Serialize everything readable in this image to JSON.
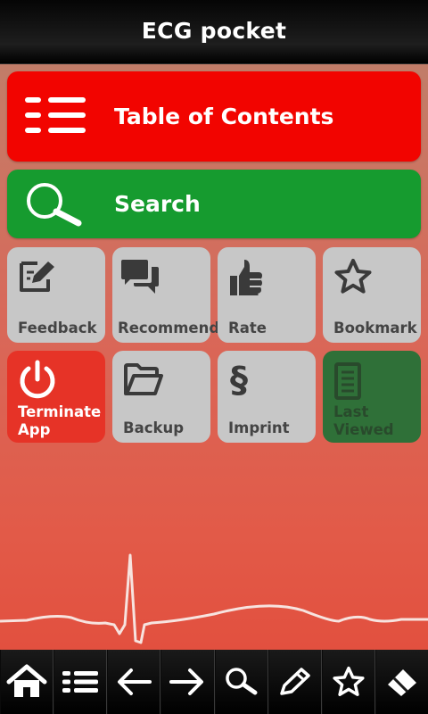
{
  "app": {
    "title": "ECG pocket"
  },
  "main": {
    "toc": {
      "label": "Table of Contents",
      "icon": "list-icon",
      "color": "#f20400"
    },
    "search": {
      "label": "Search",
      "icon": "magnifier-icon",
      "color": "#169b2f"
    }
  },
  "tiles": {
    "feedback": {
      "label": "Feedback",
      "icon": "edit-note-icon"
    },
    "recommend": {
      "label": "Recommend",
      "icon": "speech-bubbles-icon"
    },
    "rate": {
      "label": "Rate",
      "icon": "thumbs-up-icon"
    },
    "bookmark": {
      "label": "Bookmark",
      "icon": "star-icon"
    },
    "terminate": {
      "label_line1": "Terminate",
      "label_line2": "App",
      "icon": "power-icon",
      "color": "#e63327"
    },
    "backup": {
      "label": "Backup",
      "icon": "folder-icon"
    },
    "imprint": {
      "label": "Imprint",
      "icon": "paragraph-icon"
    },
    "last_viewed": {
      "label_line1": "Last",
      "label_line2": "Viewed",
      "icon": "document-icon",
      "color": "#2f7038"
    }
  },
  "bottom_nav": {
    "items": [
      {
        "icon": "home-icon"
      },
      {
        "icon": "list-icon"
      },
      {
        "icon": "arrow-left-icon"
      },
      {
        "icon": "arrow-right-icon"
      },
      {
        "icon": "search-icon"
      },
      {
        "icon": "pencil-icon"
      },
      {
        "icon": "star-icon"
      },
      {
        "icon": "eraser-icon"
      }
    ]
  }
}
